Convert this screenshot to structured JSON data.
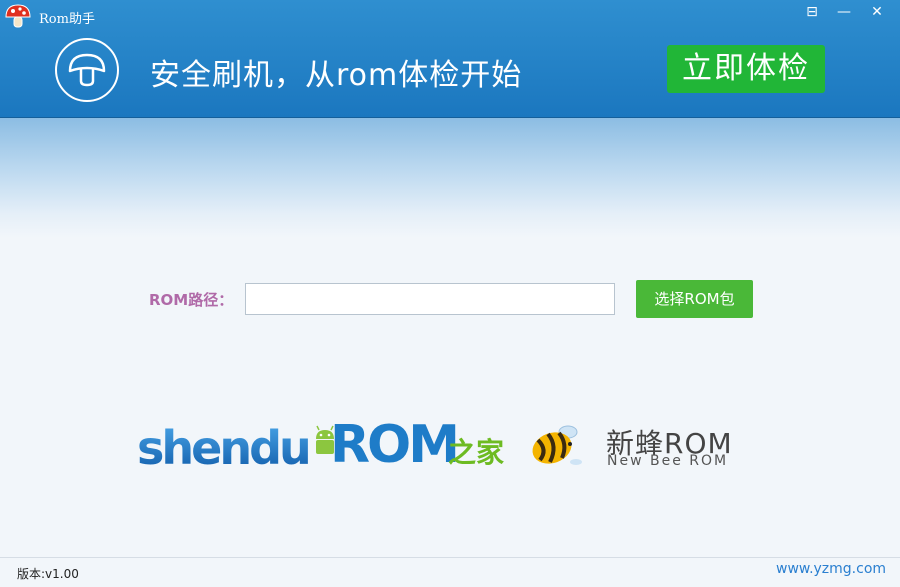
{
  "window": {
    "title": "Rom助手",
    "menu_glyph": "⊟",
    "minimize_glyph": "—",
    "close_glyph": "✕"
  },
  "header": {
    "slogan": "安全刷机，从rom体检开始",
    "check_button": "立即体检"
  },
  "rom_path": {
    "label": "ROM路径：",
    "value": "",
    "select_button": "选择ROM包"
  },
  "partners": {
    "shendu": "shendu",
    "romzj_main": "ROM",
    "romzj_cn": "之家",
    "newbee_cn": "新蜂ROM",
    "newbee_en": "New Bee ROM"
  },
  "footer": {
    "version": "版本:v1.00",
    "site": "www.yzmg.com"
  },
  "colors": {
    "header_blue": "#1b77bf",
    "check_green": "#21b637",
    "select_green": "#4ab838",
    "label_purple": "#b06aa8",
    "link_blue": "#2a7fd0"
  },
  "icons": [
    "mushroom-app-icon",
    "menu-icon",
    "minimize-icon",
    "close-icon",
    "mushroom-outline-icon",
    "android-icon",
    "bee-icon"
  ]
}
